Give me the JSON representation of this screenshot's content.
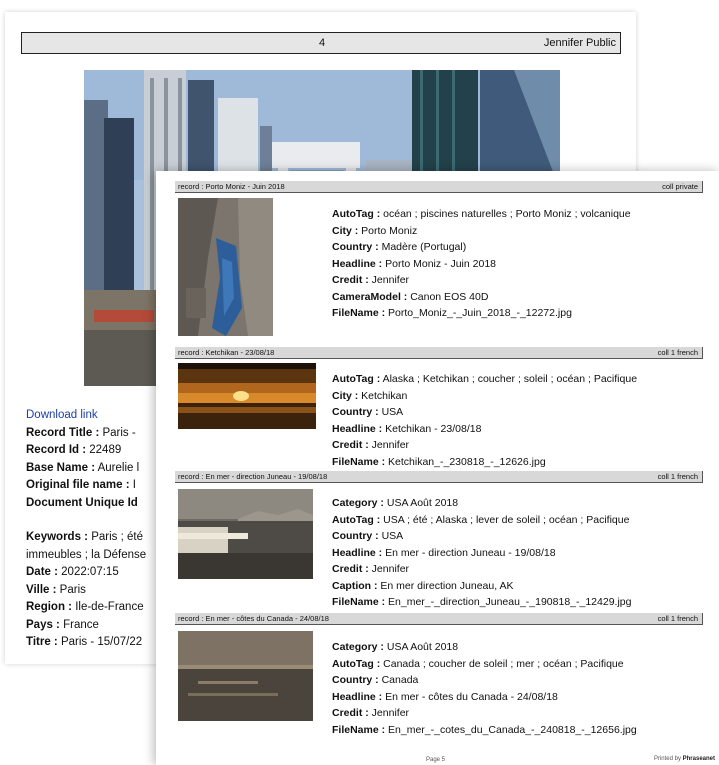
{
  "back_page": {
    "header": {
      "page_number": "4",
      "author": "Jennifer Public"
    },
    "download_link": "Download link",
    "fields": [
      {
        "label": "Record Title :",
        "value": "Paris -"
      },
      {
        "label": "Record Id :",
        "value": "22489"
      },
      {
        "label": "Base Name :",
        "value": "Aurelie l"
      },
      {
        "label": "Original file name :",
        "value": "I"
      },
      {
        "label": "Document Unique Id",
        "value": ""
      }
    ],
    "fields2": [
      {
        "label": "Keywords :",
        "value": "Paris ; été"
      },
      {
        "label": "",
        "value": "immeubles ; la Défense"
      },
      {
        "label": "Date :",
        "value": "2022:07:15"
      },
      {
        "label": "Ville :",
        "value": "Paris"
      },
      {
        "label": "Region :",
        "value": "Ile-de-France"
      },
      {
        "label": "Pays :",
        "value": "France"
      },
      {
        "label": "Titre :",
        "value": "Paris - 15/07/22"
      }
    ]
  },
  "records": [
    {
      "title": "record : Porto Moniz - Juin 2018",
      "collection": "coll private",
      "fields": [
        {
          "label": "AutoTag :",
          "value": "océan ; piscines naturelles ; Porto Moniz ; volcanique"
        },
        {
          "label": "City :",
          "value": "Porto Moniz"
        },
        {
          "label": "Country :",
          "value": "Madère (Portugal)"
        },
        {
          "label": "Headline :",
          "value": "Porto Moniz - Juin 2018"
        },
        {
          "label": "Credit :",
          "value": "Jennifer"
        },
        {
          "label": "CameraModel :",
          "value": "Canon EOS 40D"
        },
        {
          "label": "FileName :",
          "value": "Porto_Moniz_-_Juin_2018_-_12272.jpg"
        }
      ]
    },
    {
      "title": "record : Ketchikan - 23/08/18",
      "collection": "coll 1 french",
      "fields": [
        {
          "label": "AutoTag :",
          "value": "Alaska ; Ketchikan ; coucher ; soleil ; océan ; Pacifique"
        },
        {
          "label": "City :",
          "value": "Ketchikan"
        },
        {
          "label": "Country :",
          "value": "USA"
        },
        {
          "label": "Headline :",
          "value": "Ketchikan - 23/08/18"
        },
        {
          "label": "Credit :",
          "value": "Jennifer"
        },
        {
          "label": "FileName :",
          "value": "Ketchikan_-_230818_-_12626.jpg"
        }
      ]
    },
    {
      "title": "record : En mer - direction Juneau - 19/08/18",
      "collection": "coll 1 french",
      "fields": [
        {
          "label": "Category :",
          "value": "USA Août 2018"
        },
        {
          "label": "AutoTag :",
          "value": "USA ; été ; Alaska ; lever de soleil ; océan ; Pacifique"
        },
        {
          "label": "Country :",
          "value": "USA"
        },
        {
          "label": "Headline :",
          "value": "En mer - direction Juneau - 19/08/18"
        },
        {
          "label": "Credit :",
          "value": "Jennifer"
        },
        {
          "label": "Caption :",
          "value": "En mer direction Juneau, AK"
        },
        {
          "label": "FileName :",
          "value": "En_mer_-_direction_Juneau_-_190818_-_12429.jpg"
        }
      ]
    },
    {
      "title": "record : En mer - côtes du Canada - 24/08/18",
      "collection": "coll 1 french",
      "fields": [
        {
          "label": "Category :",
          "value": "USA Août 2018"
        },
        {
          "label": "AutoTag :",
          "value": "Canada ; coucher de soleil ; mer ; océan ; Pacifique"
        },
        {
          "label": "Country :",
          "value": "Canada"
        },
        {
          "label": "Headline :",
          "value": "En mer - côtes du Canada - 24/08/18"
        },
        {
          "label": "Credit :",
          "value": "Jennifer"
        },
        {
          "label": "FileName :",
          "value": "En_mer_-_cotes_du_Canada_-_240818_-_12656.jpg"
        }
      ]
    }
  ],
  "footer": {
    "page": "Page 5",
    "printed_by": "Printed by",
    "brand": "Phraseanet"
  }
}
